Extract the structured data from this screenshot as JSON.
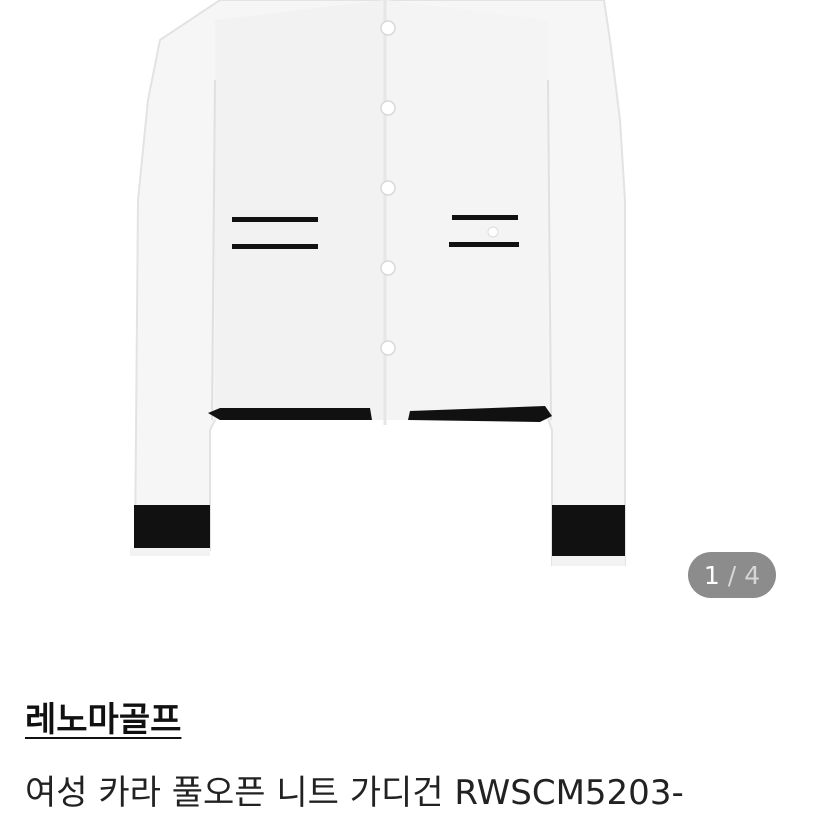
{
  "gallery": {
    "current_page": "1",
    "separator": "/",
    "total_pages": "4",
    "image_subject": "white cardigan with black trim"
  },
  "product": {
    "brand": "레노마골프",
    "title": "여성 카라 풀오픈 니트 가디건 RWSCM5203-"
  },
  "colors": {
    "indicator_bg": "#8c8c8c",
    "garment": "#f6f6f6",
    "trim": "#111111"
  }
}
